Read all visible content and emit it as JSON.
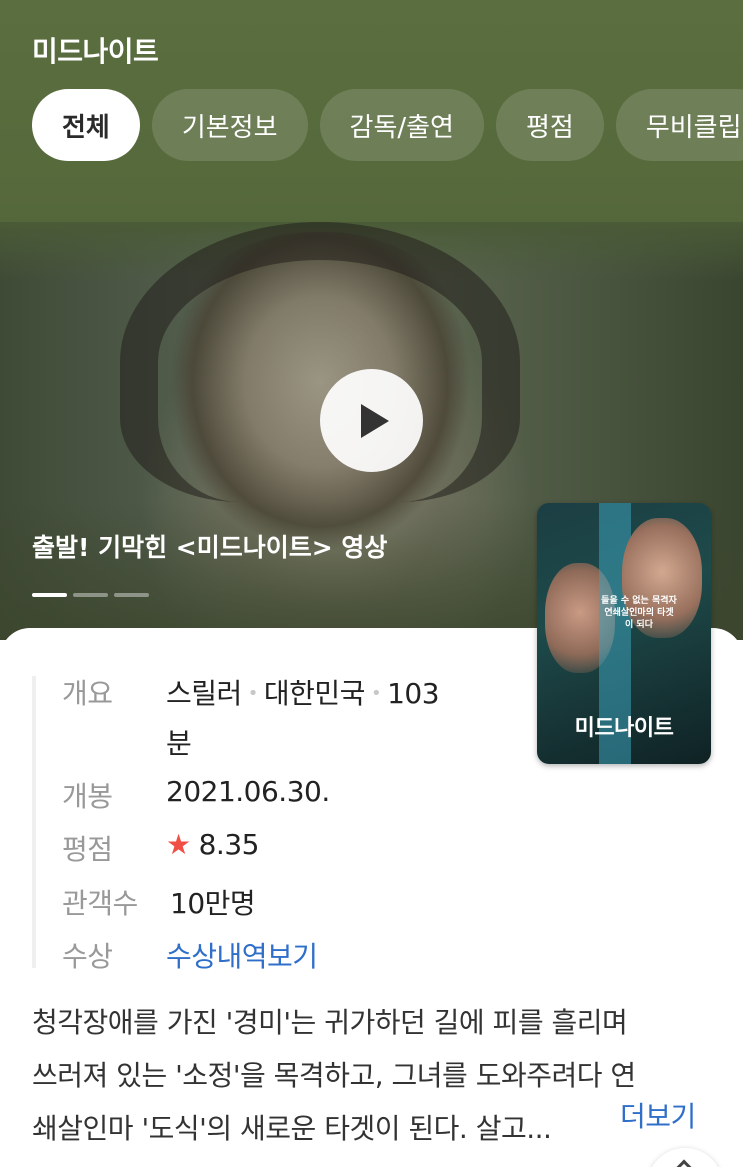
{
  "header": {
    "title": "미드나이트",
    "tabs": [
      {
        "label": "전체",
        "active": true
      },
      {
        "label": "기본정보",
        "active": false
      },
      {
        "label": "감독/출연",
        "active": false
      },
      {
        "label": "평점",
        "active": false
      },
      {
        "label": "무비클립",
        "active": false
      }
    ]
  },
  "video": {
    "caption": "출발! 기막힌 <미드나이트> 영상",
    "play_icon": "play-icon",
    "slides_total": 3,
    "slide_active": 1
  },
  "poster": {
    "title": "미드나이트",
    "tagline": "들을 수 없는 목격자 연쇄살인마의 타겟이 되다"
  },
  "info": {
    "overview_label": "개요",
    "genre": "스릴러",
    "country": "대한민국",
    "runtime": "103분",
    "release_label": "개봉",
    "release_date": "2021.06.30.",
    "rating_label": "평점",
    "rating_value": "8.35",
    "audience_label": "관객수",
    "audience_value": "10만명",
    "awards_label": "수상",
    "awards_link": "수상내역보기"
  },
  "synopsis": {
    "line1": "청각장애를 가진 '경미'는 귀가하던 길에 피를 흘리며",
    "line2": "쓰러져 있는 '소정'을 목격하고, 그녀를 도와주려다 연",
    "line3": "쇄살인마 '도식'의 새로운 타겟이 된다. 살고...",
    "more_label": "더보기"
  },
  "colors": {
    "header_bg": "#56693c",
    "link_blue": "#2f6fc9",
    "star_red": "#f04f45"
  }
}
